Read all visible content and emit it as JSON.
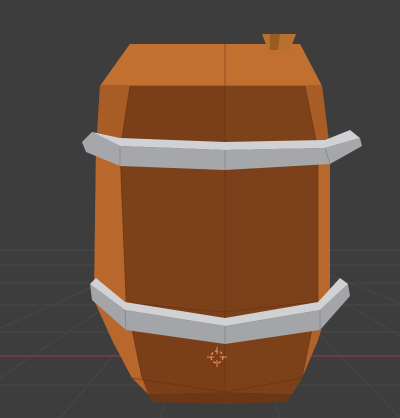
{
  "viewport": {
    "background_color": "#3d3d3d",
    "grid_line_color": "#474747",
    "x_axis_color": "#8a3b4a"
  },
  "object": {
    "type": "barrel",
    "wood_color": "#b5652a",
    "wood_dark_color": "#7a3f18",
    "band_color": "#a8aaad",
    "stopper_color": "#b8702f"
  },
  "gizmo": {
    "icon": "3d-cursor-icon",
    "color": "#e4895b"
  }
}
